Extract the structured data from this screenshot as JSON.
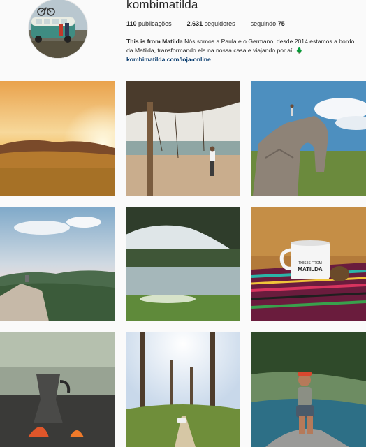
{
  "profile": {
    "username": "kombimatilda",
    "stats": {
      "posts_count": "110",
      "posts_label": "publicações",
      "followers_count": "2.631",
      "followers_label": "seguidores",
      "following_label": "seguindo",
      "following_count": "75"
    },
    "bio": {
      "name": "This is from Matilda",
      "text": "Nós somos a Paula e o Germano, desde 2014 estamos a bordo da Matilda, transformando ela na nossa casa e viajando por aí! 🌲",
      "link": "kombimatilda.com/loja-online"
    }
  },
  "mug_text": {
    "line1": "THIS IS FROM",
    "line2": "MATILDA"
  }
}
